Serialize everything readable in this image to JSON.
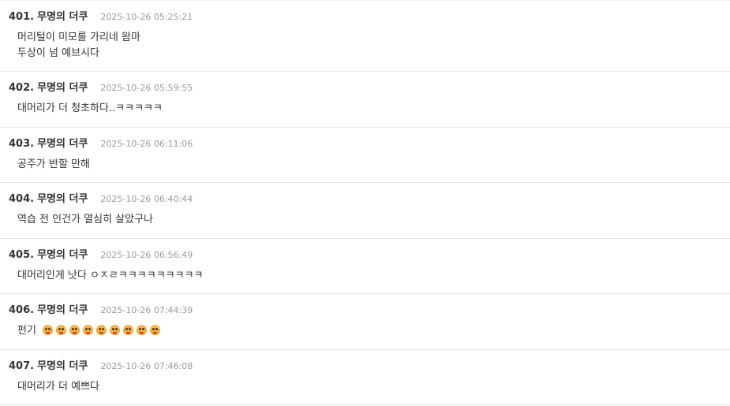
{
  "comments": [
    {
      "num": "401.",
      "author": "무명의 더쿠",
      "date": "2025-10-26 05:25:21",
      "lines": [
        "머리털이 미모를 가리네 왐마",
        "두상이 넘 예브시다"
      ]
    },
    {
      "num": "402.",
      "author": "무명의 더쿠",
      "date": "2025-10-26 05:59:55",
      "lines": [
        "대머리가 더 청초하다..ㅋㅋㅋㅋㅋ"
      ]
    },
    {
      "num": "403.",
      "author": "무명의 더쿠",
      "date": "2025-10-26 06:11:06",
      "lines": [
        "공주가 반할 만해"
      ]
    },
    {
      "num": "404.",
      "author": "무명의 더쿠",
      "date": "2025-10-26 06:40:44",
      "lines": [
        "역습 전 인건가 열심히 살았구나"
      ]
    },
    {
      "num": "405.",
      "author": "무명의 더쿠",
      "date": "2025-10-26 06:56:49",
      "lines": [
        "대머리인게 낫다 ㅇㅈㄹㅋㅋㅋㅋㅋㅋㅋㅋㅋ"
      ]
    },
    {
      "num": "406.",
      "author": "무명의 더쿠",
      "date": "2025-10-26 07:44:39",
      "lines": [
        "펀기"
      ],
      "emoji_count": 9,
      "emoji_icon": "crying-face-icon"
    },
    {
      "num": "407.",
      "author": "무명의 더쿠",
      "date": "2025-10-26 07:46:08",
      "lines": [
        "대머리가 더 예쁘다"
      ]
    }
  ]
}
